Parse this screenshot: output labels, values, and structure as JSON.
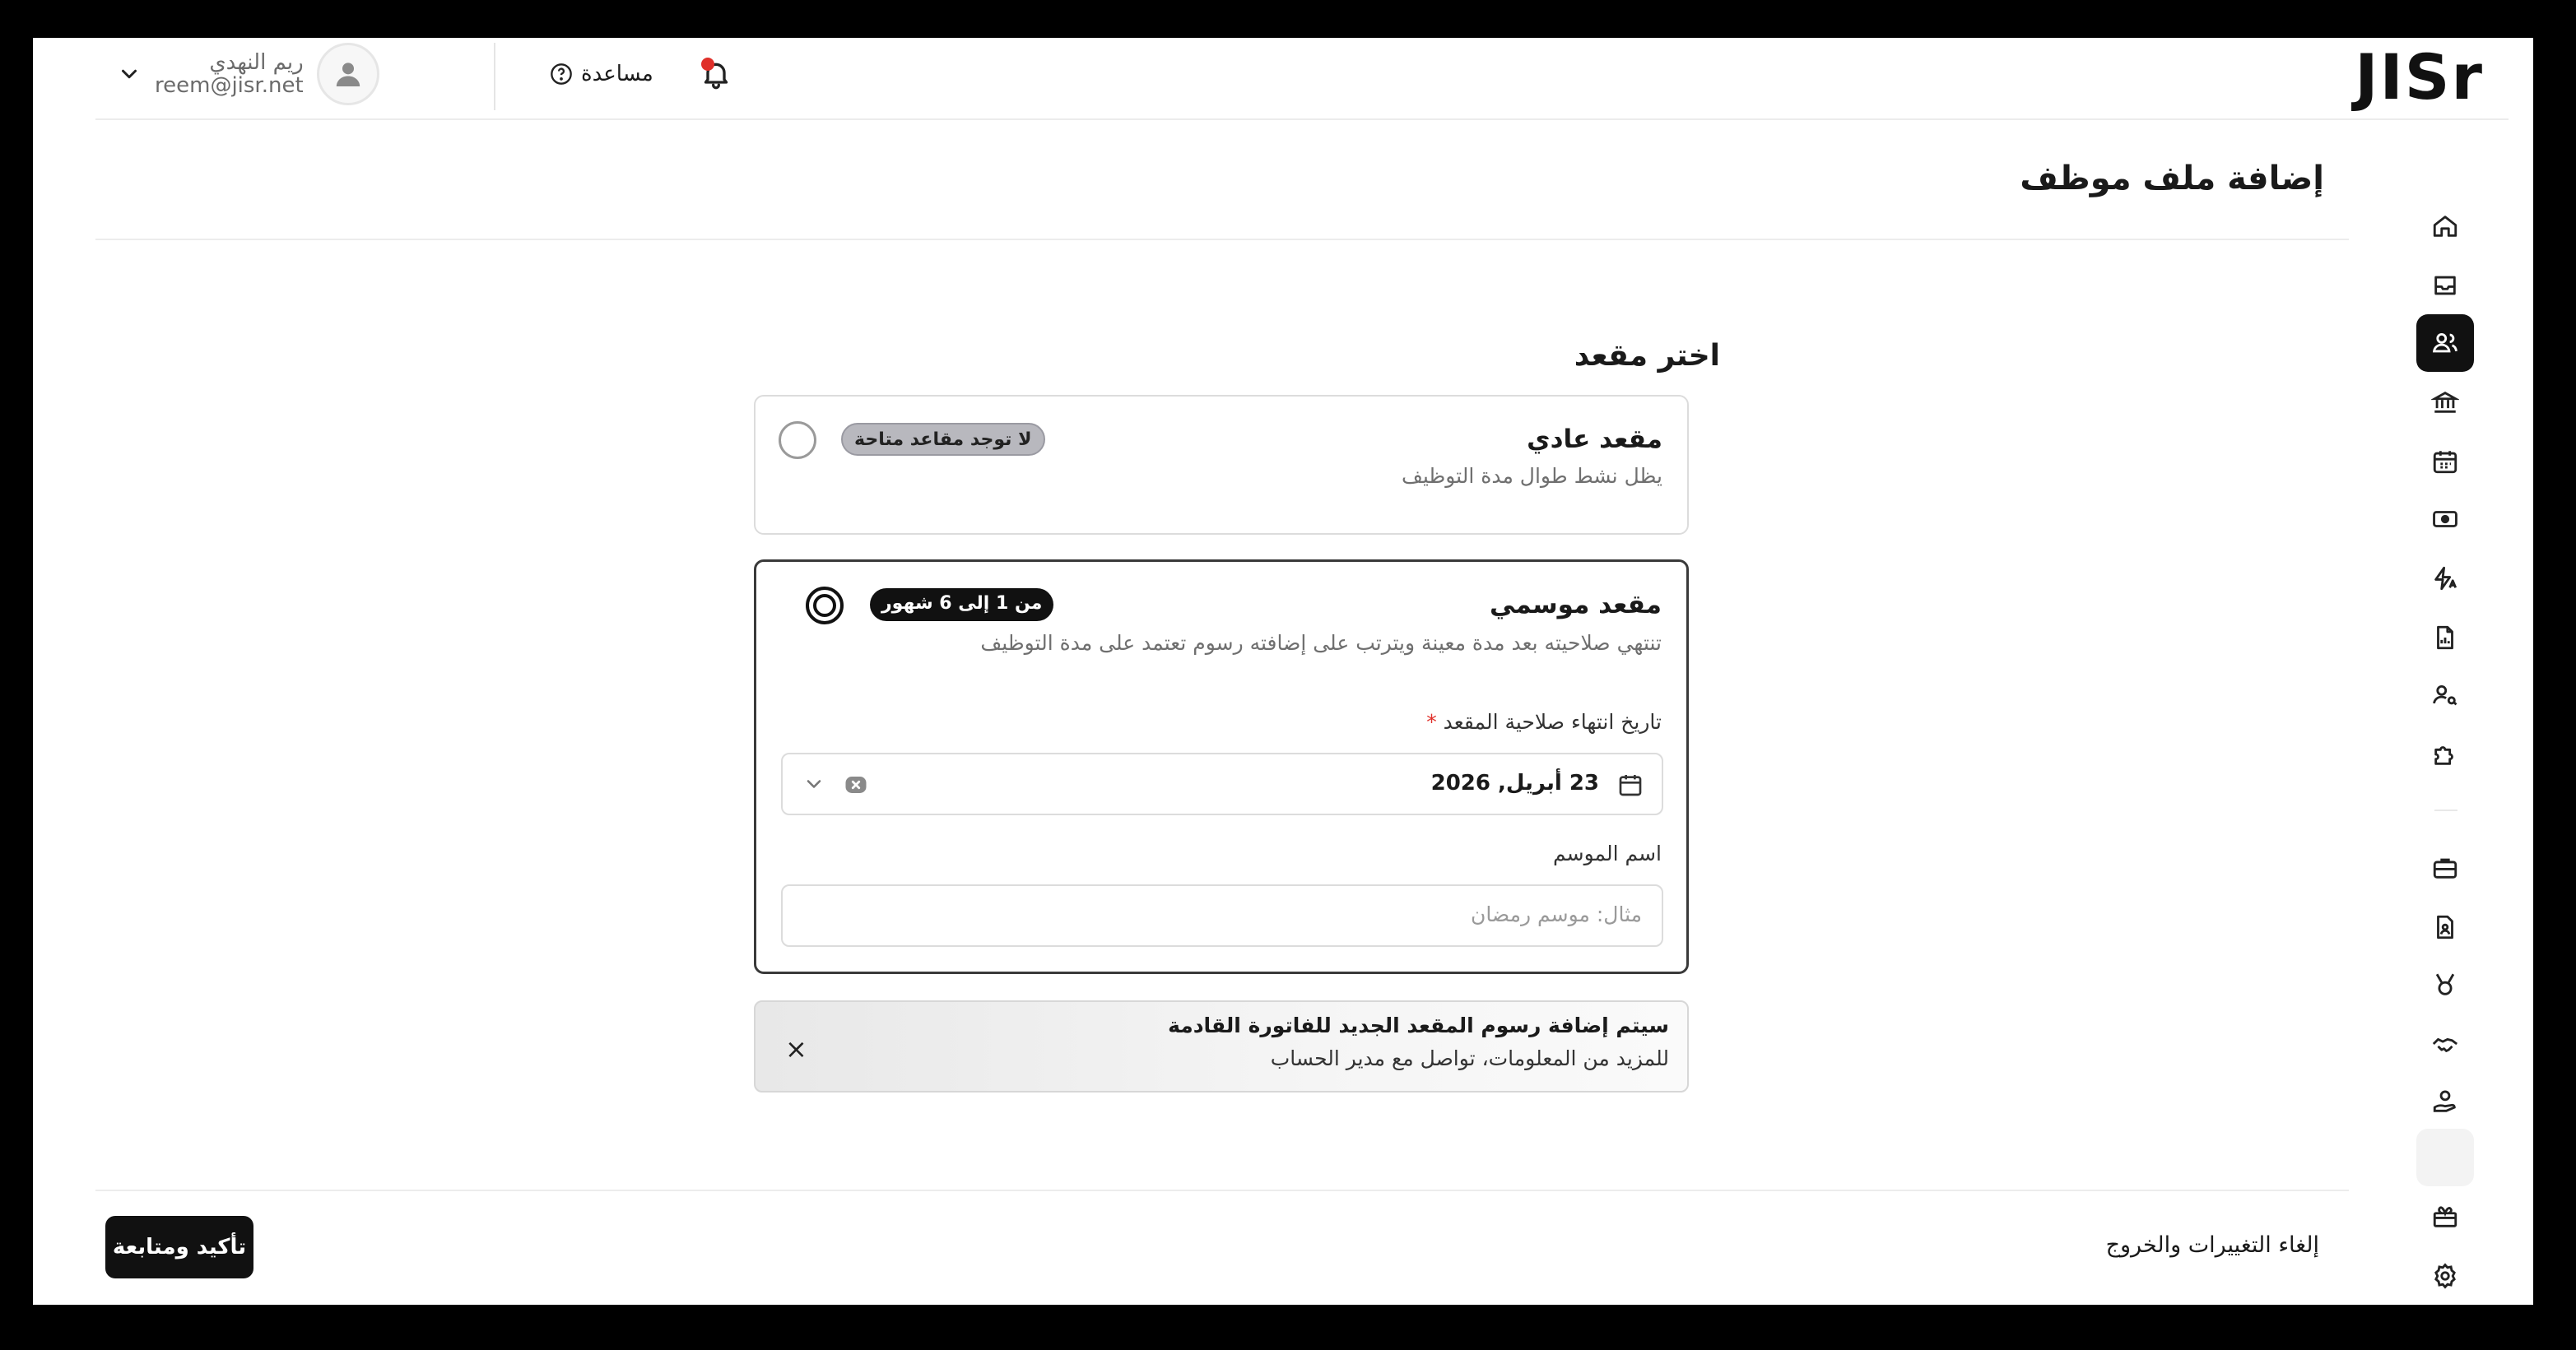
{
  "app": {
    "logo_text": "JISr"
  },
  "topbar": {
    "help_label": "مساعدة",
    "user_name": "ريم النهدي",
    "user_email": "reem@jisr.net"
  },
  "sidebar": {
    "items": [
      "home-icon",
      "inbox-icon",
      "users-icon",
      "bank-icon",
      "calendar-icon",
      "money-icon",
      "automation-icon",
      "report-icon",
      "user-key-icon",
      "puzzle-icon",
      "briefcase-icon",
      "id-document-icon",
      "medal-icon",
      "handshake-icon",
      "hand-coin-icon",
      "blank-icon",
      "gift-icon",
      "gear-icon"
    ],
    "active_index": 2
  },
  "page": {
    "title": "إضافة ملف موظف"
  },
  "form": {
    "section_title": "اختر مقعد",
    "regular": {
      "title": "مقعد عادي",
      "description": "يظل نشط طوال مدة التوظيف",
      "badge": "لا توجد مقاعد متاحة"
    },
    "seasonal": {
      "title": "مقعد موسمي",
      "description": "تنتهي صلاحيته بعد مدة معينة ويترتب على إضافته رسوم تعتمد على مدة التوظيف",
      "badge": "من 1 إلى 6 شهور",
      "expiry_label": "تاريخ انتهاء صلاحية المقعد",
      "required_mark": "*",
      "expiry_value": "23 أبريل, 2026",
      "season_label": "اسم الموسم",
      "season_placeholder": "مثال: موسم رمضان"
    },
    "notice": {
      "title": "سيتم إضافة رسوم المقعد الجديد للفاتورة القادمة",
      "subtitle": "للمزيد من المعلومات، تواصل مع مدير الحساب",
      "close": "×"
    }
  },
  "footer": {
    "cancel_label": "إلغاء التغييرات والخروج",
    "confirm_label": "تأكيد ومتابعة"
  }
}
